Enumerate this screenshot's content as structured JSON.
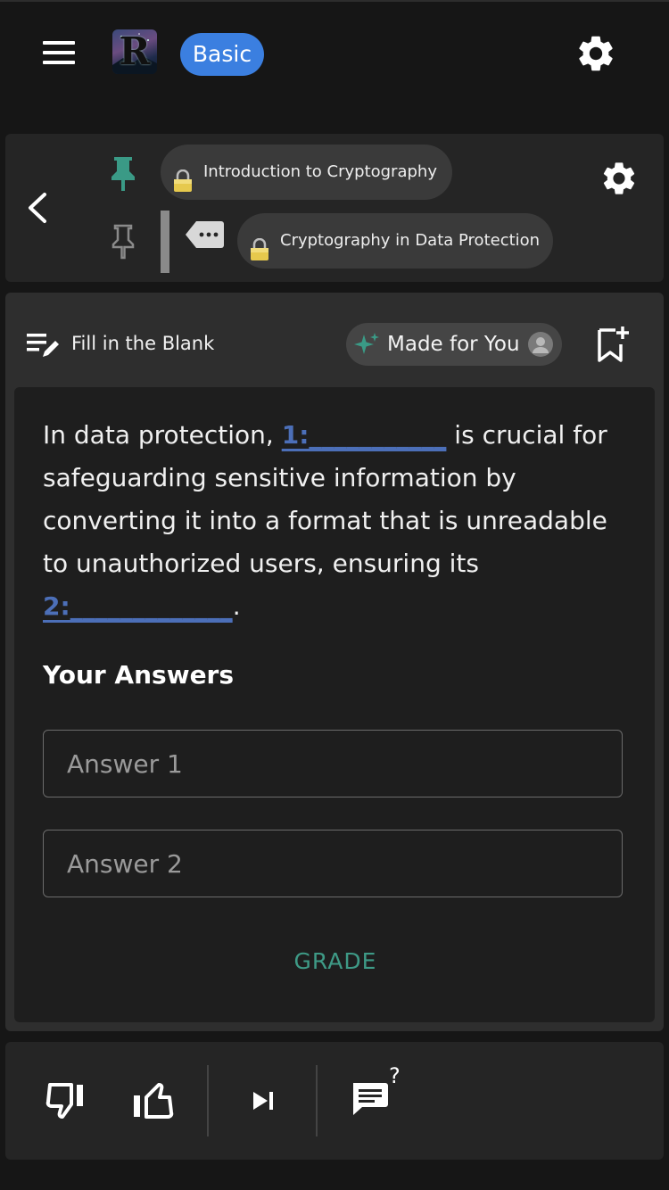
{
  "app": {
    "logo_letter": "R",
    "plan_badge": "Basic"
  },
  "topics": {
    "pinned_topic": "Introduction to Cryptography",
    "current_topic": "Cryptography in Data Protection"
  },
  "question_header": {
    "type_label": "Fill in the Blank",
    "made_for_you": "Made for You"
  },
  "question": {
    "part1": "In data protection, ",
    "blank1": "1:___________",
    "part2": " is crucial for safeguarding sensitive information by converting it into a format that is unreadable to unauthorized users, ensuring its ",
    "blank2": "2:_____________",
    "part3": "."
  },
  "answers": {
    "title": "Your Answers",
    "answer1_placeholder": "Answer 1",
    "answer2_placeholder": "Answer 2",
    "grade_label": "GRADE"
  },
  "colors": {
    "accent_blue": "#3b7fe0",
    "pin_active": "#3a9a86",
    "grade": "#3e9a86",
    "blank": "#4c6fb8"
  },
  "icons": [
    "menu-icon",
    "gear-icon",
    "chevron-left-icon",
    "pin-icon",
    "tag-icon",
    "lock-icon",
    "edit-list-icon",
    "sparkle-icon",
    "avatar-icon",
    "bookmark-add-icon",
    "thumb-down-icon",
    "thumb-up-icon",
    "skip-next-icon",
    "chat-question-icon"
  ]
}
